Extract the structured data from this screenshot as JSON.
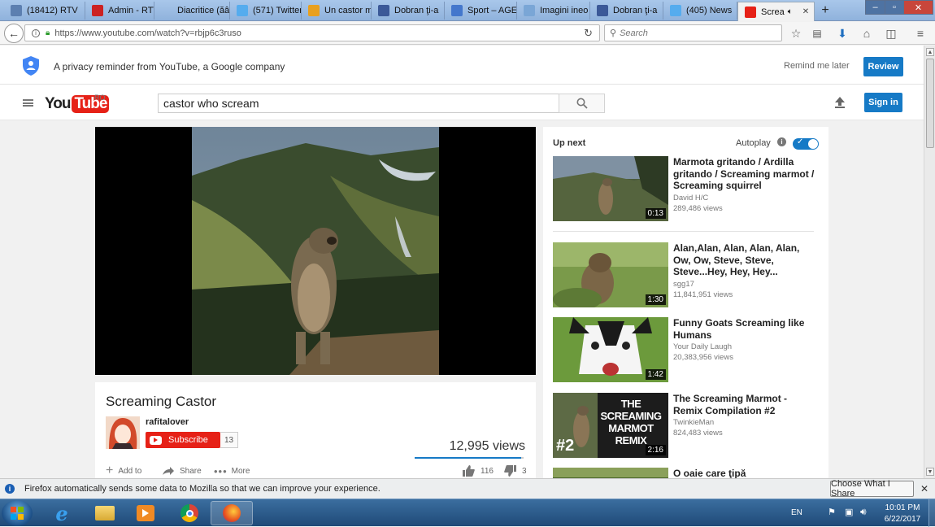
{
  "tabs": [
    {
      "label": "(18412) RTV",
      "icon": "rtv-icon",
      "color": "#5c7fb0"
    },
    {
      "label": "Admin - RTV",
      "icon": "admin-icon",
      "color": "#cc2222"
    },
    {
      "label": "Diacritice (ăâîșț)",
      "icon": "diacritice-icon",
      "color": ""
    },
    {
      "label": "(571) Twitter",
      "icon": "twitter-icon",
      "color": "#55acee"
    },
    {
      "label": "Un castor m",
      "icon": "pencil-icon",
      "color": "#e8a020"
    },
    {
      "label": "Dobran ţi-a",
      "icon": "facebook-icon",
      "color": "#3b5998"
    },
    {
      "label": "Sport – AGE",
      "icon": "sport-icon",
      "color": "#4477cc"
    },
    {
      "label": "Imagini ineo",
      "icon": "generic-page-icon",
      "color": "#7aa6d6"
    },
    {
      "label": "Dobran ţi-a",
      "icon": "facebook-icon",
      "color": "#3b5998"
    },
    {
      "label": "(405) News",
      "icon": "twitter-icon",
      "color": "#55acee"
    },
    {
      "label": "Screa",
      "icon": "youtube-icon",
      "color": "#e62117"
    }
  ],
  "url": "https://www.youtube.com/watch?v=rbjp6c3ruso",
  "browser_search_placeholder": "Search",
  "privacy": {
    "text": "A privacy reminder from YouTube, a Google company",
    "remind": "Remind me later",
    "review": "Review"
  },
  "header": {
    "logo_you": "You",
    "logo_tube": "Tube",
    "region": "RO",
    "search_value": "castor who scream",
    "signin": "Sign in"
  },
  "video": {
    "title": "Screaming Castor",
    "channel": "rafitalover",
    "subscribe": "Subscribe",
    "subscribers": "13",
    "views": "12,995 views",
    "add_to": "Add to",
    "share": "Share",
    "more": "More",
    "likes": "116",
    "dislikes": "3",
    "like_ratio": 0.975
  },
  "upnext": {
    "label": "Up next",
    "autoplay": "Autoplay",
    "autoplay_on": true,
    "items": [
      {
        "title": "Marmota gritando / Ardilla gritando / Screaming marmot / Screaming squirrel",
        "channel": "David H/C",
        "views": "289,486 views",
        "duration": "0:13"
      },
      {
        "title": "Alan,Alan, Alan, Alan, Alan, Ow, Ow, Steve, Steve, Steve...Hey, Hey, Hey...",
        "channel": "sgg17",
        "views": "11,841,951 views",
        "duration": "1:30"
      },
      {
        "title": "Funny Goats Screaming like Humans",
        "channel": "Your Daily Laugh",
        "views": "20,383,956 views",
        "duration": "1:42"
      },
      {
        "title": "The Screaming Marmot - Remix Compilation #2",
        "channel": "TwinkieMan",
        "views": "824,483 views",
        "duration": "2:16",
        "overlay": "THE SCREAMING MARMOT REMIX",
        "overlay_num": "#2"
      },
      {
        "title": "O oaie care ţipă",
        "channel": "",
        "views": "",
        "duration": ""
      }
    ]
  },
  "notification": {
    "text": "Firefox automatically sends some data to Mozilla so that we can improve your experience.",
    "button": "Choose What I Share"
  },
  "taskbar": {
    "lang": "EN",
    "time": "10:01 PM",
    "date": "6/22/2017"
  }
}
